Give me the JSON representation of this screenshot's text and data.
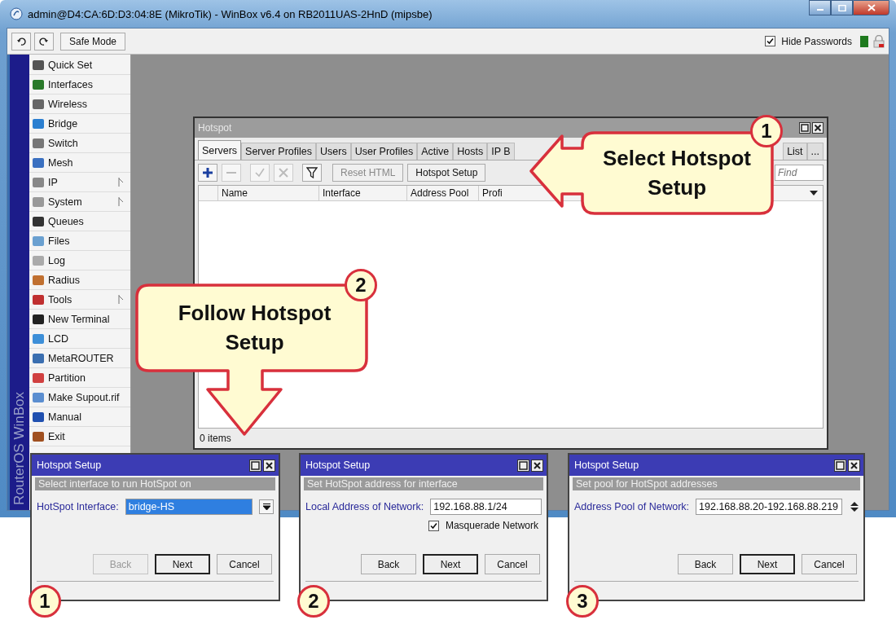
{
  "window": {
    "title": "admin@D4:CA:6D:D3:04:8E (MikroTik) - WinBox v6.4 on RB2011UAS-2HnD (mipsbe)"
  },
  "toolbar": {
    "safe_mode": "Safe Mode",
    "hide_passwords": {
      "label": "Hide Passwords",
      "checked": true
    }
  },
  "sidebar": {
    "brand": "RouterOS WinBox",
    "items": [
      {
        "label": "Quick Set",
        "submenu": false
      },
      {
        "label": "Interfaces",
        "submenu": false
      },
      {
        "label": "Wireless",
        "submenu": false
      },
      {
        "label": "Bridge",
        "submenu": false
      },
      {
        "label": "Switch",
        "submenu": false
      },
      {
        "label": "Mesh",
        "submenu": false
      },
      {
        "label": "IP",
        "submenu": true
      },
      {
        "label": "System",
        "submenu": true
      },
      {
        "label": "Queues",
        "submenu": false
      },
      {
        "label": "Files",
        "submenu": false
      },
      {
        "label": "Log",
        "submenu": false
      },
      {
        "label": "Radius",
        "submenu": false
      },
      {
        "label": "Tools",
        "submenu": true
      },
      {
        "label": "New Terminal",
        "submenu": false
      },
      {
        "label": "LCD",
        "submenu": false
      },
      {
        "label": "MetaROUTER",
        "submenu": false
      },
      {
        "label": "Partition",
        "submenu": false
      },
      {
        "label": "Make Supout.rif",
        "submenu": false
      },
      {
        "label": "Manual",
        "submenu": false
      },
      {
        "label": "Exit",
        "submenu": false
      }
    ]
  },
  "hotspot_window": {
    "title": "Hotspot",
    "tabs": [
      {
        "label": "Servers",
        "selected": true
      },
      {
        "label": "Server Profiles",
        "selected": false
      },
      {
        "label": "Users",
        "selected": false
      },
      {
        "label": "User Profiles",
        "selected": false
      },
      {
        "label": "Active",
        "selected": false
      },
      {
        "label": "Hosts",
        "selected": false
      },
      {
        "label": "IP B",
        "selected": false
      }
    ],
    "tabs_right": [
      {
        "label": "List",
        "selected": false
      },
      {
        "label": "...",
        "selected": false
      }
    ],
    "tools": [
      {
        "kind": "add",
        "disabled": false
      },
      {
        "kind": "remove",
        "disabled": true
      },
      {
        "kind": "enable",
        "disabled": true
      },
      {
        "kind": "disable",
        "disabled": true
      },
      {
        "kind": "filter",
        "disabled": false
      }
    ],
    "buttons": [
      {
        "label": "Reset HTML",
        "disabled": true
      },
      {
        "label": "Hotspot Setup",
        "disabled": false
      }
    ],
    "find": {
      "placeholder": "Find"
    },
    "columns": [
      "Name",
      "Interface",
      "Address Pool",
      "Profi"
    ],
    "status": "0 items"
  },
  "dialogs": [
    {
      "title": "Hotspot Setup",
      "subtitle": "Select interface to run HotSpot on",
      "step": "1",
      "field": {
        "label": "HotSpot Interface:",
        "value": "bridge-HS",
        "highlighted": true,
        "kind": "dropdown"
      },
      "buttons": [
        {
          "label": "Back",
          "disabled": true,
          "default": false
        },
        {
          "label": "Next",
          "disabled": false,
          "default": true
        },
        {
          "label": "Cancel",
          "disabled": false,
          "default": false
        }
      ]
    },
    {
      "title": "Hotspot Setup",
      "subtitle": "Set HotSpot address for interface",
      "step": "2",
      "field": {
        "label": "Local Address of Network:",
        "value": "192.168.88.1/24",
        "highlighted": false,
        "kind": "plain"
      },
      "checkbox": {
        "label": "Masquerade Network",
        "checked": true
      },
      "buttons": [
        {
          "label": "Back",
          "disabled": false,
          "default": false
        },
        {
          "label": "Next",
          "disabled": false,
          "default": true
        },
        {
          "label": "Cancel",
          "disabled": false,
          "default": false
        }
      ]
    },
    {
      "title": "Hotspot Setup",
      "subtitle": "Set pool for HotSpot addresses",
      "step": "3",
      "field": {
        "label": "Address Pool of Network:",
        "value": "192.168.88.20-192.168.88.219",
        "highlighted": false,
        "kind": "spinner"
      },
      "buttons": [
        {
          "label": "Back",
          "disabled": false,
          "default": false
        },
        {
          "label": "Next",
          "disabled": false,
          "default": true
        },
        {
          "label": "Cancel",
          "disabled": false,
          "default": false
        }
      ]
    }
  ],
  "callouts": [
    {
      "kind": "left",
      "number": "1",
      "text": "Select Hotspot Setup"
    },
    {
      "kind": "down",
      "number": "2",
      "text": "Follow Hotspot Setup"
    }
  ]
}
